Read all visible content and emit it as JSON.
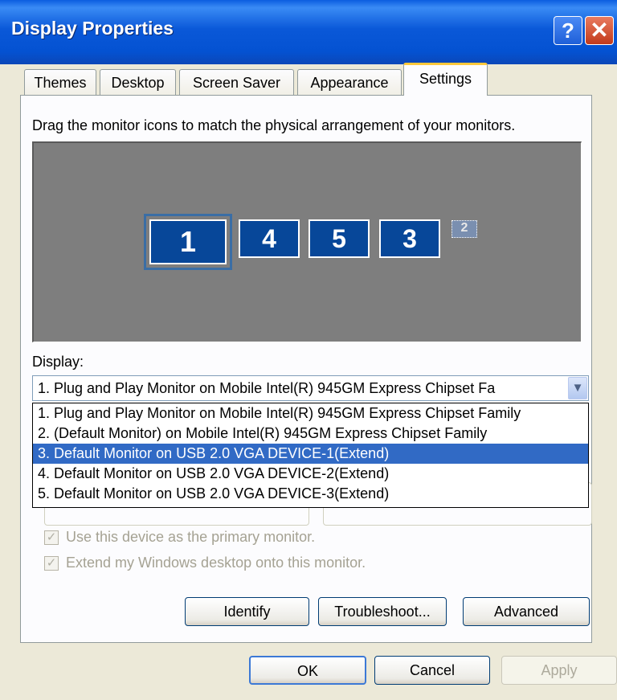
{
  "window": {
    "title": "Display Properties",
    "help_label": "?",
    "close_label": "✕"
  },
  "tabs": [
    {
      "label": "Themes"
    },
    {
      "label": "Desktop"
    },
    {
      "label": "Screen Saver"
    },
    {
      "label": "Appearance"
    },
    {
      "label": "Settings",
      "active": true
    }
  ],
  "settings": {
    "instruction": "Drag the monitor icons to match the physical arrangement of your monitors.",
    "monitors": [
      {
        "number": "1",
        "selected": true
      },
      {
        "number": "4"
      },
      {
        "number": "5"
      },
      {
        "number": "3"
      },
      {
        "number": "2",
        "inactive": true
      }
    ],
    "display_label": "Display:",
    "display_value": "1. Plug and Play Monitor on Mobile Intel(R) 945GM Express Chipset Fa",
    "display_options": [
      "1. Plug and Play Monitor on Mobile Intel(R) 945GM Express Chipset Family",
      "2. (Default Monitor) on Mobile Intel(R) 945GM Express Chipset Family",
      "3. Default Monitor on USB 2.0 VGA DEVICE-1(Extend)",
      "4. Default Monitor on USB 2.0 VGA DEVICE-2(Extend)",
      "5. Default Monitor on USB 2.0 VGA DEVICE-3(Extend)"
    ],
    "highlighted_option_index": 2,
    "checkbox_primary": "Use this device as the primary monitor.",
    "checkbox_extend": "Extend my Windows desktop onto this monitor.",
    "identify_label": "Identify",
    "troubleshoot_label": "Troubleshoot...",
    "advanced_label": "Advanced"
  },
  "footer": {
    "ok_label": "OK",
    "cancel_label": "Cancel",
    "apply_label": "Apply"
  },
  "colors": {
    "title_bar": "#0A58D8",
    "monitor_fill": "#074799",
    "selection": "#316AC5",
    "dialog_bg": "#ECE9D8"
  }
}
